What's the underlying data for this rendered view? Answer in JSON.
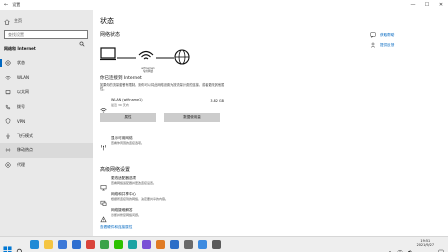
{
  "window": {
    "back_glyph": "←",
    "title": "设置",
    "controls": [
      "—",
      "☐",
      "✕"
    ]
  },
  "sidebar": {
    "home_label": "主页",
    "search_placeholder": "查找设置",
    "section_title": "网络和 Internet",
    "items": [
      {
        "label": "状态",
        "icon": "status-icon",
        "active": true
      },
      {
        "label": "WLAN",
        "icon": "wifi-icon"
      },
      {
        "label": "以太网",
        "icon": "ethernet-icon"
      },
      {
        "label": "拨号",
        "icon": "dialup-icon"
      },
      {
        "label": "VPN",
        "icon": "vpn-icon"
      },
      {
        "label": "飞行模式",
        "icon": "airplane-icon"
      },
      {
        "label": "移动热点",
        "icon": "hotspot-icon",
        "hover": true
      },
      {
        "label": "代理",
        "icon": "proxy-icon"
      }
    ]
  },
  "main": {
    "title": "状态",
    "network_status_heading": "网络状态",
    "diagram_label_line1": "wifiname1",
    "diagram_label_line2": "专用网络",
    "connected_title": "你已连接到 Internet",
    "connected_desc": "如果你的流量套餐有限制，则你可以将此网络设置为按流量计费的连接，或者更改其他属性。",
    "network_name": "WLAN (wifiname1)",
    "network_sub": "最近 30 天内",
    "network_usage": "3.82 GB",
    "btn_properties": "属性",
    "btn_data_usage": "数据使用量",
    "show_networks_title": "显示可用网络",
    "show_networks_desc": "查看你周围的连接选项。",
    "advanced_heading": "高级网络设置",
    "adv_items": [
      {
        "title": "更改适配器选项",
        "desc": "查看网络适配器并更改连接设置。",
        "icon": "adapter-icon"
      },
      {
        "title": "网络和共享中心",
        "desc": "根据所连接到的网络，决定要共享的内容。",
        "icon": "sharing-center-icon"
      },
      {
        "title": "网络疑难解答",
        "desc": "诊断并修复网络问题。",
        "icon": "troubleshoot-icon"
      }
    ],
    "bottom_link": "查看硬件和连接属性"
  },
  "right_links": [
    {
      "label": "获取帮助",
      "icon": "help-icon"
    },
    {
      "label": "提供反馈",
      "icon": "feedback-icon"
    }
  ],
  "taskbar": {
    "time": "19:51",
    "date": "2021/9/27",
    "apps": [
      {
        "name": "edge-app",
        "color": "#1f8ad6"
      },
      {
        "name": "file-explorer-app",
        "color": "#f4c542"
      },
      {
        "name": "store-app",
        "color": "#3c78d8"
      },
      {
        "name": "mail-app",
        "color": "#2f6fd0"
      },
      {
        "name": "app-red",
        "color": "#d9433a"
      },
      {
        "name": "app-green",
        "color": "#3aa34a"
      },
      {
        "name": "wechat-app",
        "color": "#2dc100"
      },
      {
        "name": "app-teal",
        "color": "#1aa3a3"
      },
      {
        "name": "app-purple",
        "color": "#7a4fd6"
      },
      {
        "name": "app-orange",
        "color": "#e07b24"
      },
      {
        "name": "app-blue2",
        "color": "#2c6ec8"
      },
      {
        "name": "app-gray",
        "color": "#6a6a6a"
      },
      {
        "name": "app-blue3",
        "color": "#3d8be0"
      },
      {
        "name": "settings-app",
        "color": "#5a5a5a"
      }
    ]
  },
  "colors": {
    "accent": "#0067c0",
    "sidebar_bg": "#e9e9e9",
    "button_bg": "#cccccc"
  }
}
